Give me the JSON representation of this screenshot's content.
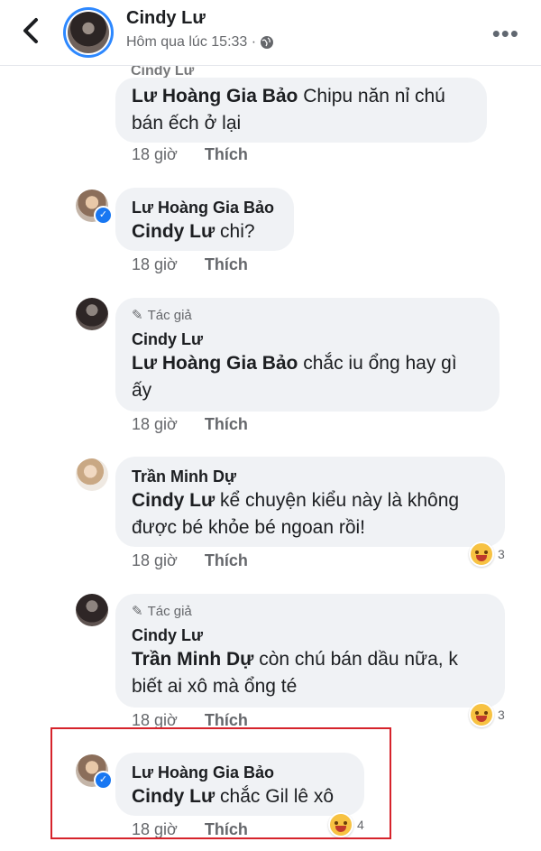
{
  "header": {
    "name": "Cindy Lư",
    "time": "Hôm qua lúc 15:33 ·",
    "icons": [
      "back-chevron-icon",
      "globe-icon",
      "more-dots-icon"
    ]
  },
  "cut_author": "Cindy Lư",
  "comments": [
    {
      "author": "",
      "mention": "Lư Hoàng Gia Bảo",
      "text_line1": " Chipu năn nỉ chú",
      "text_line2": "bán ếch ở lại",
      "time": "18 giờ",
      "like": "Thích"
    },
    {
      "author": "Lư Hoàng Gia Bảo",
      "mention": "Cindy Lư",
      "text_line1": " chi?",
      "time": "18 giờ",
      "like": "Thích"
    },
    {
      "badge": "Tác giả",
      "author": "Cindy Lư",
      "mention": "Lư Hoàng Gia Bảo",
      "text_line1": " chắc iu ổng hay gì",
      "text_line2": "ấy",
      "time": "18 giờ",
      "like": "Thích"
    },
    {
      "author": "Trần Minh Dự",
      "mention": "Cindy Lư",
      "text_line1": " kể chuyện kiểu này là không",
      "text_line2": "được bé khỏe bé ngoan rồi!",
      "time": "18 giờ",
      "like": "Thích",
      "reaction_count": "3"
    },
    {
      "badge": "Tác giả",
      "author": "Cindy Lư",
      "mention": "Trần Minh Dự",
      "text_line1": " còn chú bán dầu nữa, k",
      "text_line2": "biết ai xô mà ổng té",
      "time": "18 giờ",
      "like": "Thích",
      "reaction_count": "3"
    },
    {
      "author": "Lư Hoàng Gia Bảo",
      "mention": "Cindy Lư",
      "text_line1": " chắc Gil lê xô",
      "time": "18 giờ",
      "like": "Thích",
      "reaction_count": "4"
    }
  ],
  "colors": {
    "link_blue": "#1877f2",
    "bubble": "#f0f2f5",
    "highlight": "#d6232b"
  }
}
